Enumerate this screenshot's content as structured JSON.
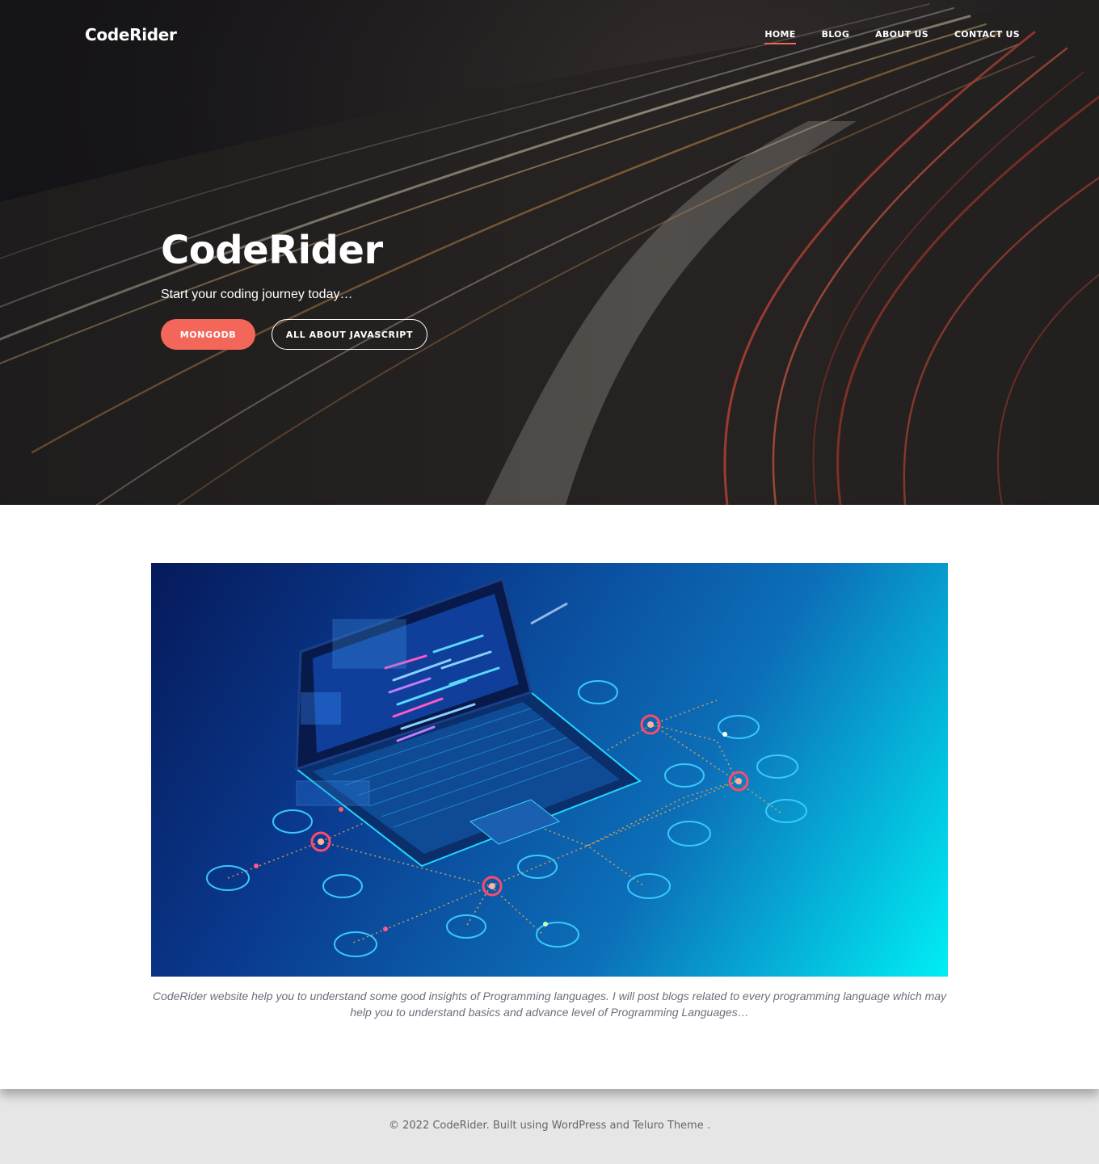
{
  "site": {
    "brand": "CodeRider"
  },
  "nav": {
    "items": [
      {
        "label": "HOME",
        "active": true
      },
      {
        "label": "BLOG",
        "active": false
      },
      {
        "label": "ABOUT US",
        "active": false
      },
      {
        "label": "CONTACT US",
        "active": false
      }
    ]
  },
  "hero": {
    "title": "CodeRider",
    "subtitle": "Start your coding journey today…",
    "buttons": {
      "primary": "MONGODB",
      "secondary": "ALL ABOUT JAVASCRIPT"
    }
  },
  "main": {
    "caption": "CodeRider website help you to understand some good insights of Programming languages. I will post blogs related to every programming language which may help you to understand basics and advance level of Programming Languages…"
  },
  "footer": {
    "text": "© 2022 CodeRider. Built using WordPress and Teluro Theme ."
  },
  "colors": {
    "accent": "#f2675a",
    "footer_bg": "#e6e6e6"
  }
}
